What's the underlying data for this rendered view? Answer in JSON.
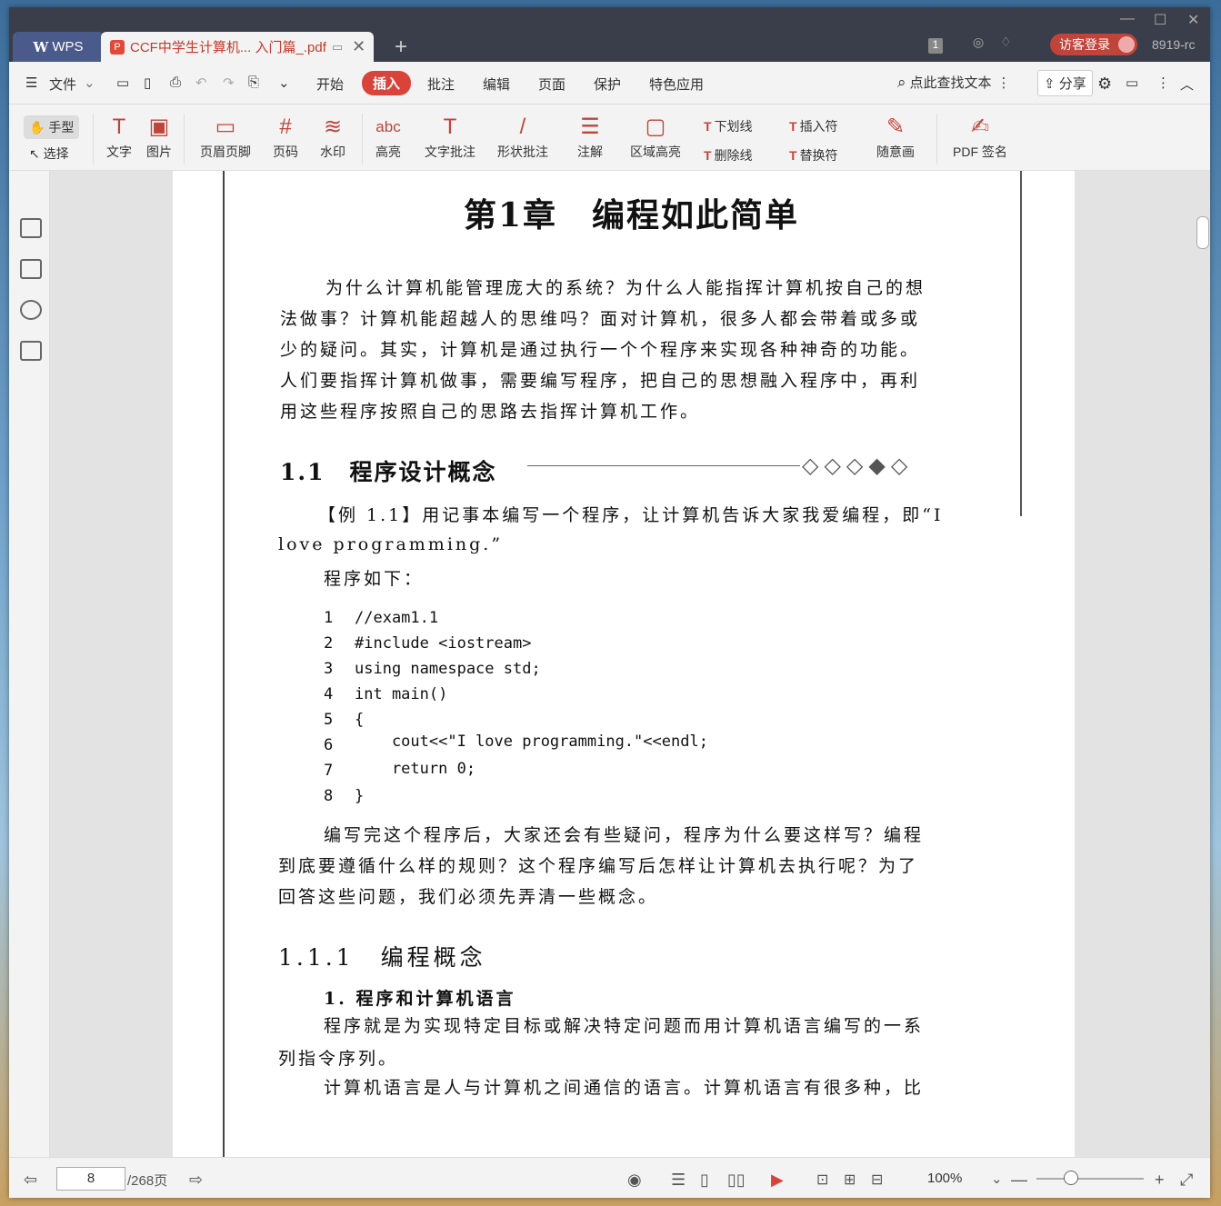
{
  "app": {
    "name": "WPS",
    "doc_tab": "CCF中学生计算机... 入门篇_.pdf",
    "login": "访客登录",
    "user": "8919-rc",
    "badge": "1"
  },
  "menu": {
    "file": "文件",
    "items": [
      "开始",
      "插入",
      "批注",
      "编辑",
      "页面",
      "保护",
      "特色应用"
    ],
    "active_index": 1,
    "search": "点此查找文本",
    "share": "分享"
  },
  "ribbon": {
    "hand": "手型",
    "select": "选择",
    "groups": [
      {
        "label": "文字",
        "icon": "T"
      },
      {
        "label": "图片",
        "icon": "▣"
      },
      {
        "label": "页眉页脚",
        "icon": "▭"
      },
      {
        "label": "页码",
        "icon": "#"
      },
      {
        "label": "水印",
        "icon": "≋"
      },
      {
        "label": "高亮",
        "icon": "abc"
      },
      {
        "label": "文字批注",
        "icon": "T"
      },
      {
        "label": "形状批注",
        "icon": "/"
      },
      {
        "label": "注解",
        "icon": "☰"
      },
      {
        "label": "区域高亮",
        "icon": "▢"
      }
    ],
    "small": [
      {
        "label": "下划线",
        "icon": "T"
      },
      {
        "label": "删除线",
        "icon": "T"
      },
      {
        "label": "插入符",
        "icon": "T"
      },
      {
        "label": "替换符",
        "icon": "T"
      }
    ],
    "draw": "随意画",
    "sign": "PDF 签名"
  },
  "page": {
    "chapter": "第1章　编程如此简单",
    "intro": [
      "为什么计算机能管理庞大的系统？为什么人能指挥计算机按自己的想",
      "法做事？计算机能超越人的思维吗？面对计算机，很多人都会带着或多或",
      "少的疑问。其实，计算机是通过执行一个个程序来实现各种神奇的功能。",
      "人们要指挥计算机做事，需要编写程序，把自己的思想融入程序中，再利",
      "用这些程序按照自己的思路去指挥计算机工作。"
    ],
    "sec1": "1.1　程序设计概念",
    "example": [
      "【例 1.1】用记事本编写一个程序，让计算机告诉大家我爱编程，即“I",
      "love programming.”"
    ],
    "code_intro": "程序如下：",
    "code": [
      {
        "n": "1",
        "t": "//exam1.1"
      },
      {
        "n": "2",
        "t": "#include <iostream>"
      },
      {
        "n": "3",
        "t": "using namespace std;"
      },
      {
        "n": "4",
        "t": "int main()"
      },
      {
        "n": "5",
        "t": "{"
      },
      {
        "n": "6",
        "t": "    cout<<\"I love programming.\"<<endl;"
      },
      {
        "n": "7",
        "t": "    return 0;"
      },
      {
        "n": "8",
        "t": "}"
      }
    ],
    "after": [
      "编写完这个程序后，大家还会有些疑问，程序为什么要这样写？编程",
      "到底要遵循什么样的规则？这个程序编写后怎样让计算机去执行呢？为了",
      "回答这些问题，我们必须先弄清一些概念。"
    ],
    "sec2": "1.1.1　编程概念",
    "sub1": "1. 程序和计算机语言",
    "def": [
      "程序就是为实现特定目标或解决特定问题而用计算机语言编写的一系",
      "列指令序列。",
      "计算机语言是人与计算机之间通信的语言。计算机语言有很多种，比"
    ]
  },
  "status": {
    "page": "8",
    "total": "/268页",
    "zoom": "100%",
    "zoom_fraction": 0.32
  }
}
